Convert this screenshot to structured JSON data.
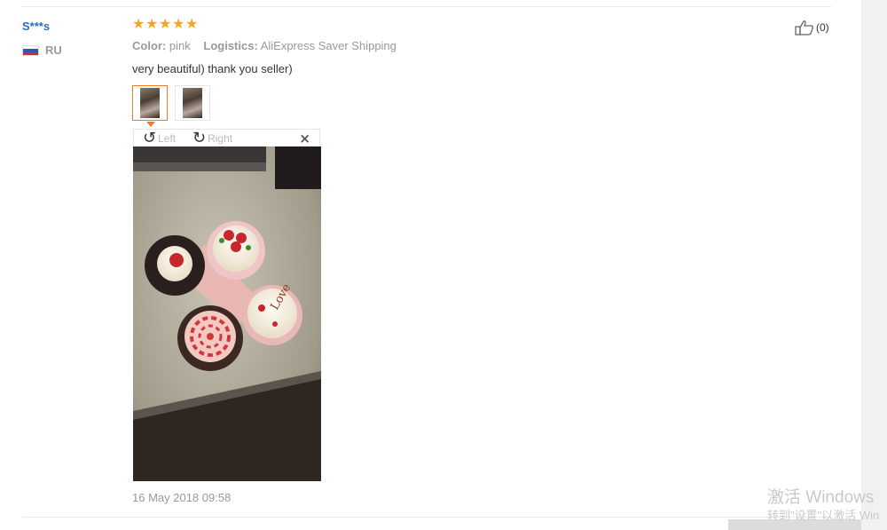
{
  "review": {
    "user_name": "S***s",
    "country": "RU",
    "rating": 5,
    "color_label": "Color:",
    "color_value": "pink",
    "logistics_label": "Logistics:",
    "logistics_value": "AliExpress Saver Shipping",
    "text": "very beautiful) thank you seller)",
    "date": "16 May 2018 09:58",
    "like_count": "(0)"
  },
  "viewer": {
    "rotate_left_label": "Left",
    "rotate_right_label": "Right",
    "close_glyph": "×"
  },
  "photo": {
    "caption_text": "Love"
  },
  "os_watermark": {
    "line1": "激活 Windows",
    "line2": "转到\"设置\"以激活 Win"
  },
  "colors": {
    "accent": "#f47b22",
    "star": "#f7a623",
    "username": "#2a6cc0"
  }
}
